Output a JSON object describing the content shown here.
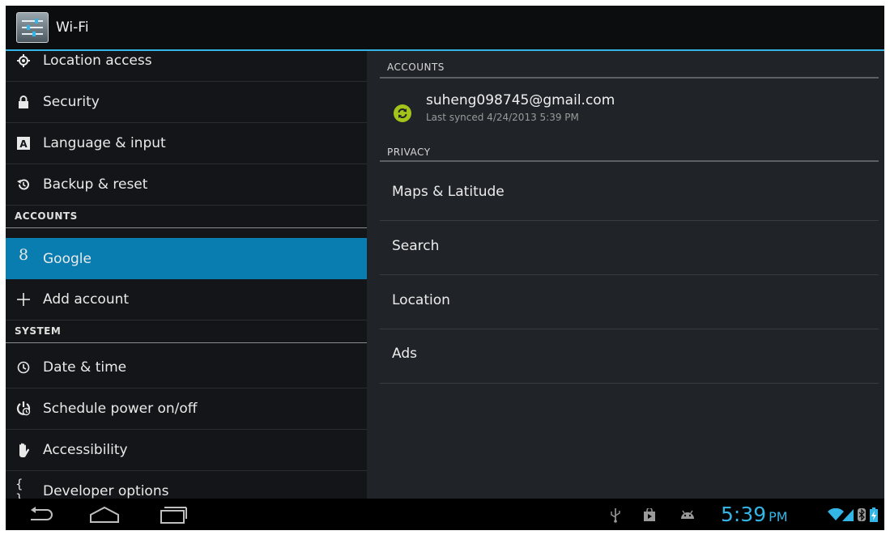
{
  "action_bar": {
    "title": "Wi-Fi",
    "icon": "settings-sliders-icon"
  },
  "left_pane": {
    "items": [
      {
        "label": "Location access",
        "icon": "location-icon"
      },
      {
        "label": "Security",
        "icon": "lock-icon"
      },
      {
        "label": "Language & input",
        "icon": "keyboard-a-icon"
      },
      {
        "label": "Backup & reset",
        "icon": "backup-icon"
      }
    ],
    "accounts_header": "ACCOUNTS",
    "accounts": [
      {
        "label": "Google",
        "icon": "google-g-icon",
        "selected": true
      },
      {
        "label": "Add account",
        "icon": "plus-icon"
      }
    ],
    "system_header": "SYSTEM",
    "system": [
      {
        "label": "Date & time",
        "icon": "clock-icon"
      },
      {
        "label": "Schedule power on/off",
        "icon": "power-schedule-icon"
      },
      {
        "label": "Accessibility",
        "icon": "hand-icon"
      },
      {
        "label": "Developer options",
        "icon": "braces-icon"
      }
    ]
  },
  "right_pane": {
    "accounts_header": "ACCOUNTS",
    "account": {
      "email": "suheng098745@gmail.com",
      "last_synced": "Last synced 4/24/2013 5:39 PM",
      "icon": "sync-icon"
    },
    "privacy_header": "PRIVACY",
    "privacy_items": [
      "Maps & Latitude",
      "Search",
      "Location",
      "Ads"
    ]
  },
  "status_bar": {
    "time": "5:39",
    "ampm": "PM",
    "icons": [
      "usb-icon",
      "store-icon",
      "android-debug-icon",
      "wifi-icon",
      "signal-icon",
      "bluetooth-icon",
      "battery-icon"
    ]
  },
  "colors": {
    "accent": "#33b5e5",
    "selected": "#0a7db0",
    "sync_green": "#a3c41b"
  }
}
